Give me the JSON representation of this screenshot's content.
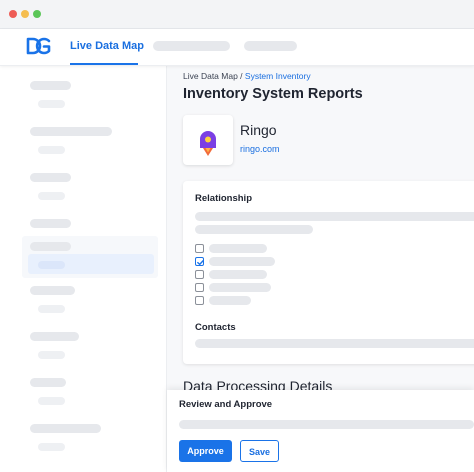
{
  "window": {
    "controls": [
      {
        "name": "close",
        "color": "#ee5c56"
      },
      {
        "name": "minimize",
        "color": "#f5bd4f"
      },
      {
        "name": "maximize",
        "color": "#5bc658"
      }
    ]
  },
  "topnav": {
    "logo_icon": "dg-logo-icon",
    "active_tab": "Live Data Map",
    "accent_color": "#1a73e8"
  },
  "breadcrumb": {
    "parent": "Live Data Map",
    "separator": " / ",
    "current": "System Inventory"
  },
  "page": {
    "title": "Inventory System Reports"
  },
  "vendor": {
    "name": "Ringo",
    "url": "ringo.com",
    "logo_icon": "rocket-icon",
    "logo_color": "#7b3fe4"
  },
  "sections": {
    "relationship": "Relationship",
    "contacts": "Contacts",
    "data_processing": "Data Processing Details"
  },
  "checklist": [
    {
      "checked": false
    },
    {
      "checked": true
    },
    {
      "checked": false
    },
    {
      "checked": false
    },
    {
      "checked": false
    }
  ],
  "review": {
    "title": "Review and Approve",
    "approve_label": "Approve",
    "save_label": "Save"
  }
}
